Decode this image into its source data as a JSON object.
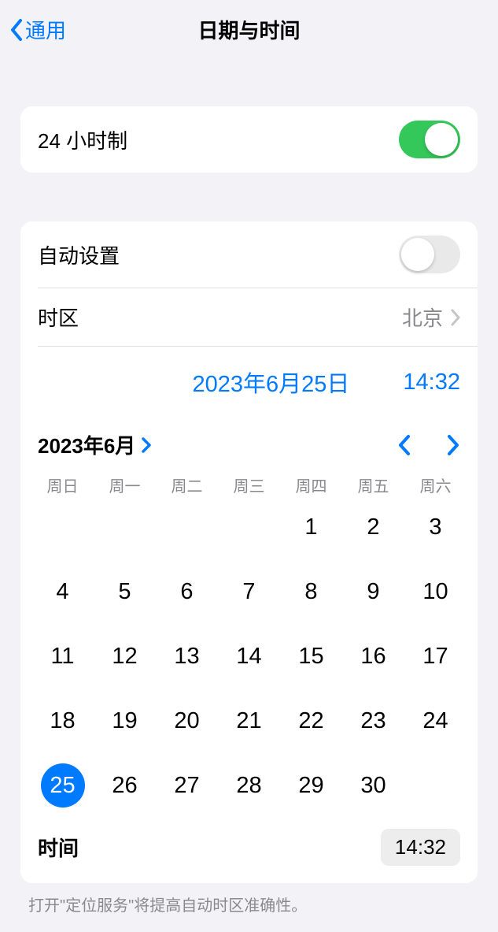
{
  "nav": {
    "back_label": "通用",
    "title": "日期与时间"
  },
  "settings": {
    "hour24_label": "24 小时制",
    "hour24_on": true,
    "auto_label": "自动设置",
    "auto_on": false,
    "timezone_label": "时区",
    "timezone_value": "北京"
  },
  "datetime": {
    "date": "2023年6月25日",
    "time": "14:32"
  },
  "calendar": {
    "month_label": "2023年6月",
    "weekdays": [
      "周日",
      "周一",
      "周二",
      "周三",
      "周四",
      "周五",
      "周六"
    ],
    "leading_blanks": 4,
    "days": [
      1,
      2,
      3,
      4,
      5,
      6,
      7,
      8,
      9,
      10,
      11,
      12,
      13,
      14,
      15,
      16,
      17,
      18,
      19,
      20,
      21,
      22,
      23,
      24,
      25,
      26,
      27,
      28,
      29,
      30
    ],
    "selected": 25
  },
  "time_row": {
    "label": "时间",
    "value": "14:32"
  },
  "footer": "打开\"定位服务\"将提高自动时区准确性。"
}
